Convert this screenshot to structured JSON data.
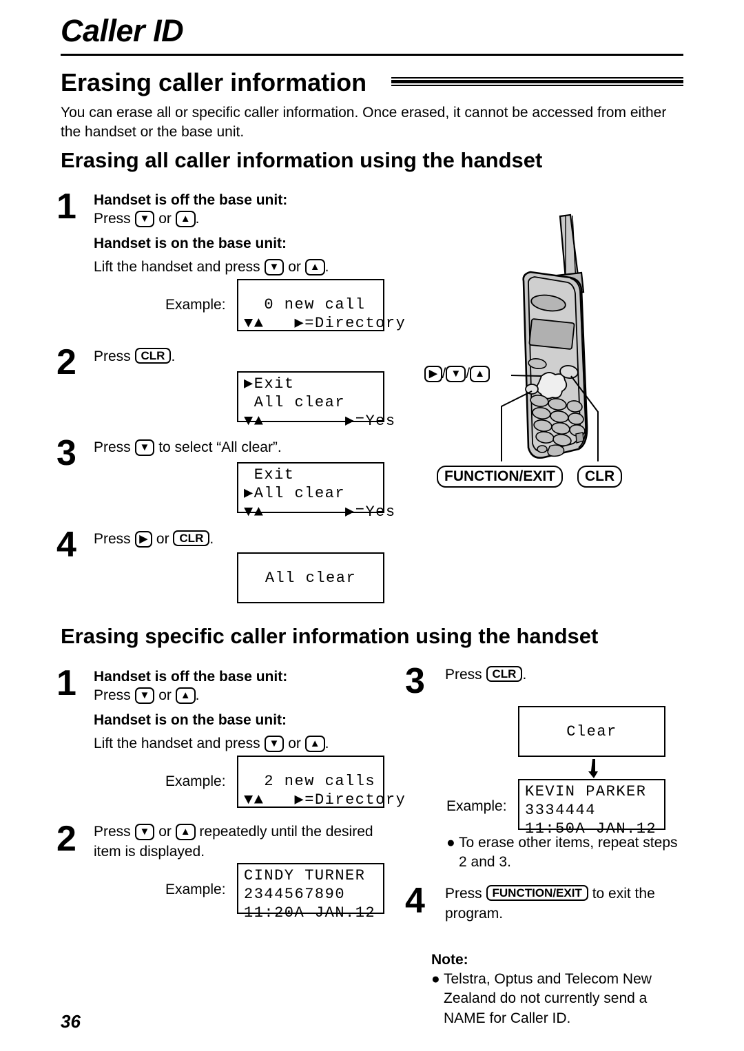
{
  "chapter": {
    "title": "Caller ID"
  },
  "section": {
    "heading": "Erasing caller information",
    "intro": "You can erase all or specific caller information. Once erased, it cannot be accessed from either the handset or the base unit."
  },
  "page": {
    "number": "36"
  },
  "labels": {
    "example": "Example:",
    "note_head": "Note:"
  },
  "keys": {
    "down": "▼",
    "up": "▲",
    "right": "▶",
    "clr": "CLR",
    "function_exit": "FUNCTION/EXIT"
  },
  "illustration": {
    "keys_label_right": "▶",
    "keys_label_down": "▼",
    "keys_label_up": "▲",
    "separator": "/",
    "callout_function_exit": "FUNCTION/EXIT",
    "callout_clr": "CLR"
  },
  "sections": [
    {
      "heading": "Erasing all caller information using the handset",
      "steps": [
        {
          "number": "1",
          "line1_bold": "Handset is off the base unit:",
          "line2_pre": "Press ",
          "line2_mid": " or ",
          "line2_post": ".",
          "line3_bold": "Handset is on the base unit:",
          "line4_pre": "Lift the handset and press ",
          "line4_mid": " or ",
          "line4_post": ".",
          "lcd": [
            "  0 new call",
            "▼▲   ▶=Directory"
          ]
        },
        {
          "number": "2",
          "text_pre": "Press ",
          "text_post": ".",
          "lcd": [
            "▶Exit",
            " All clear",
            "▼▲        ▶=Yes"
          ]
        },
        {
          "number": "3",
          "text_pre": "Press ",
          "text_post": " to select “All clear”.",
          "lcd": [
            " Exit",
            "▶All clear",
            "▼▲        ▶=Yes"
          ]
        },
        {
          "number": "4",
          "text_pre": "Press ",
          "text_mid": " or ",
          "text_post": ".",
          "lcd": [
            "All clear"
          ]
        }
      ]
    },
    {
      "heading": "Erasing specific caller information using the handset",
      "steps_left": [
        {
          "number": "1",
          "line1_bold": "Handset is off the base unit:",
          "line2_pre": "Press ",
          "line2_mid": " or ",
          "line2_post": ".",
          "line3_bold": "Handset is on the base unit:",
          "line4_pre": "Lift the handset and press ",
          "line4_mid": " or ",
          "line4_post": ".",
          "lcd": [
            "  2 new calls",
            "▼▲   ▶=Directory"
          ]
        },
        {
          "number": "2",
          "text_pre": "Press ",
          "text_mid": " or ",
          "text_post": " repeatedly until the desired item is displayed.",
          "lcd": [
            "CINDY TURNER",
            "2344567890",
            "11:20A JAN.12"
          ]
        }
      ],
      "steps_right": [
        {
          "number": "3",
          "text_pre": "Press ",
          "text_post": ".",
          "lcd_top": [
            "Clear"
          ],
          "lcd_bottom": [
            "KEVIN PARKER",
            "3334444",
            "11:50A JAN.12"
          ],
          "bullet": "To erase other items, repeat steps 2 and 3."
        },
        {
          "number": "4",
          "text_pre": "Press ",
          "text_post": " to exit the program."
        }
      ],
      "note_bullet": "Telstra, Optus and Telecom New Zealand do not currently send a NAME for Caller ID."
    }
  ]
}
